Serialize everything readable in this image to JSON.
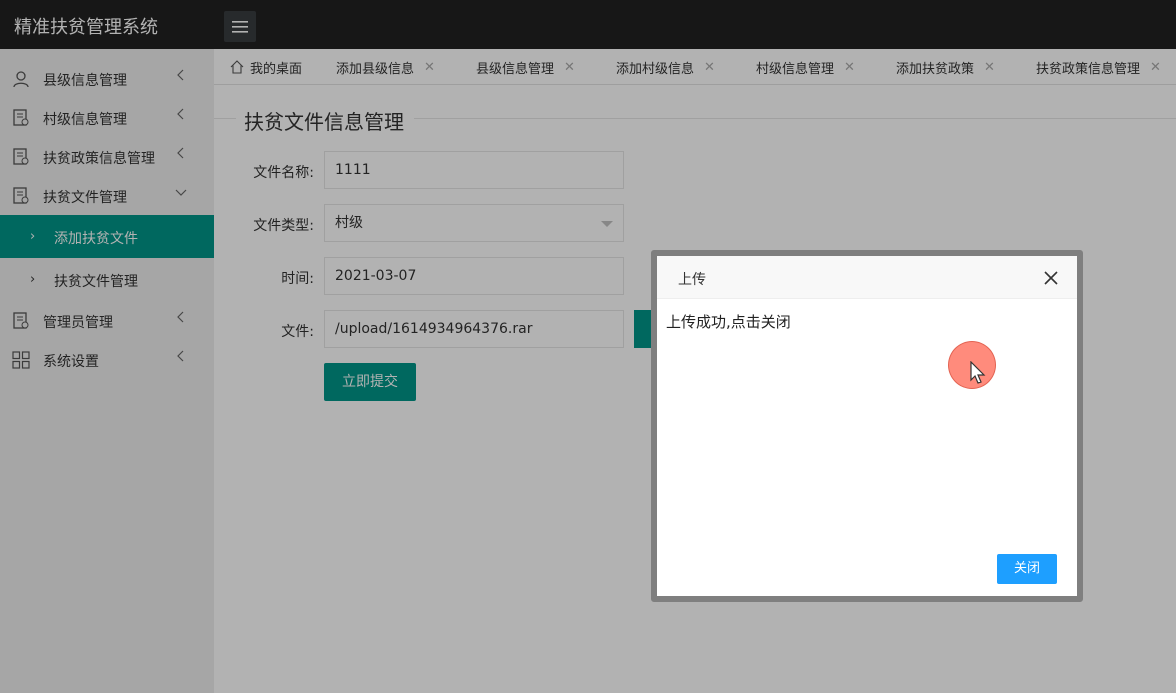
{
  "app": {
    "title": "精准扶贫管理系统",
    "menu_toggle_icon": "hamburger-icon"
  },
  "sidebar": {
    "items": [
      {
        "label": "县级信息管理",
        "icon": "user-icon",
        "expanded": false
      },
      {
        "label": "村级信息管理",
        "icon": "document-icon",
        "expanded": false
      },
      {
        "label": "扶贫政策信息管理",
        "icon": "document-icon",
        "expanded": false
      },
      {
        "label": "扶贫文件管理",
        "icon": "document-icon",
        "expanded": true
      },
      {
        "label": "管理员管理",
        "icon": "document-icon",
        "expanded": false
      },
      {
        "label": "系统设置",
        "icon": "grid-icon",
        "expanded": false
      }
    ],
    "subitems": [
      {
        "label": "添加扶贫文件",
        "active": true
      },
      {
        "label": "扶贫文件管理",
        "active": false
      }
    ]
  },
  "tabs": [
    {
      "label": "我的桌面",
      "closable": false
    },
    {
      "label": "添加县级信息",
      "closable": true
    },
    {
      "label": "县级信息管理",
      "closable": true
    },
    {
      "label": "添加村级信息",
      "closable": true
    },
    {
      "label": "村级信息管理",
      "closable": true
    },
    {
      "label": "添加扶贫政策",
      "closable": true
    },
    {
      "label": "扶贫政策信息管理",
      "closable": true
    }
  ],
  "form": {
    "legend": "扶贫文件信息管理",
    "name_label": "文件名称:",
    "name_value": "1111",
    "type_label": "文件类型:",
    "type_value": "村级",
    "time_label": "时间:",
    "time_value": "2021-03-07",
    "file_label": "文件:",
    "file_value": "/upload/1614934964376.rar",
    "submit_label": "立即提交"
  },
  "dialog": {
    "title": "上传",
    "message": "上传成功,点击关闭",
    "button_label": "关闭"
  },
  "colors": {
    "header_bg": "#222222",
    "accent": "#009688",
    "dialog_button": "#1E9FFF",
    "sidebar_bg": "#eeeeee"
  }
}
